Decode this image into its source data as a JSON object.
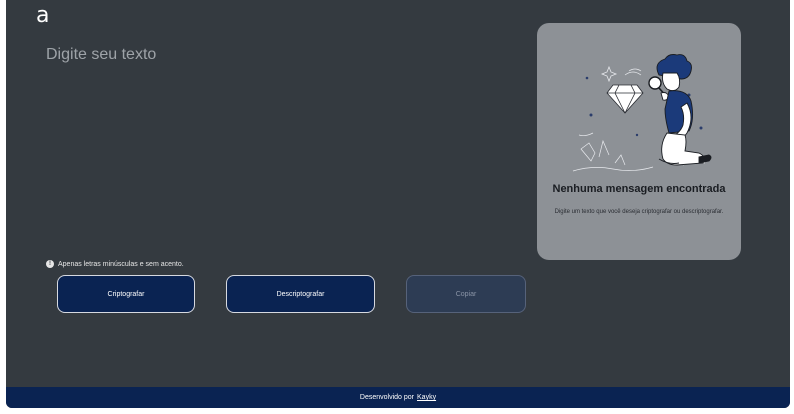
{
  "header": {
    "logo": "a"
  },
  "editor": {
    "placeholder": "Digite seu texto"
  },
  "hint": {
    "icon": "info-icon",
    "text": "Apenas letras minúsculas e sem acento."
  },
  "buttons": {
    "encrypt": "Criptografar",
    "decrypt": "Descriptografar",
    "copy": "Copiar"
  },
  "result_panel": {
    "title": "Nenhuma mensagem encontrada",
    "subtitle": "Digite um texto que você deseja criptografar ou descriptografar."
  },
  "footer": {
    "text": "Desenvolvido por",
    "author": "Kayky"
  },
  "colors": {
    "background": "#343a40",
    "primary": "#0a2352",
    "panel": "#8d9196"
  }
}
